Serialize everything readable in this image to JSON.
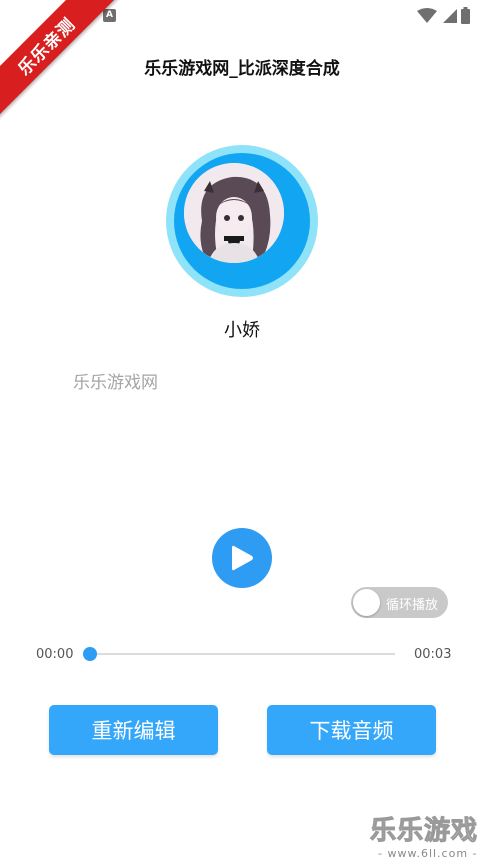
{
  "status_bar": {
    "notif_icon_a": "A",
    "icons": [
      "notification-icon",
      "text-icon",
      "wifi-icon",
      "signal-icon",
      "battery-icon"
    ]
  },
  "ribbon": {
    "label": "乐乐亲测"
  },
  "header": {
    "title": "乐乐游戏网_比派深度合成",
    "back_icon": "back-arrow-icon"
  },
  "speaker": {
    "name": "小娇"
  },
  "content": {
    "text": "乐乐游戏网"
  },
  "player": {
    "loop_label": "循环播放",
    "loop_enabled": false,
    "time_current": "00:00",
    "time_total": "00:03",
    "progress": 0
  },
  "actions": {
    "re_edit": "重新编辑",
    "download": "下载音频"
  },
  "watermark": {
    "title": "乐乐游戏",
    "url": "- www.6ll.com -"
  },
  "colors": {
    "accent": "#2e9cf3",
    "button": "#35a7fa",
    "ribbon": "#d81e1e",
    "ring_outer": "#8fe3f8",
    "ring_inner": "#12a6f2"
  }
}
